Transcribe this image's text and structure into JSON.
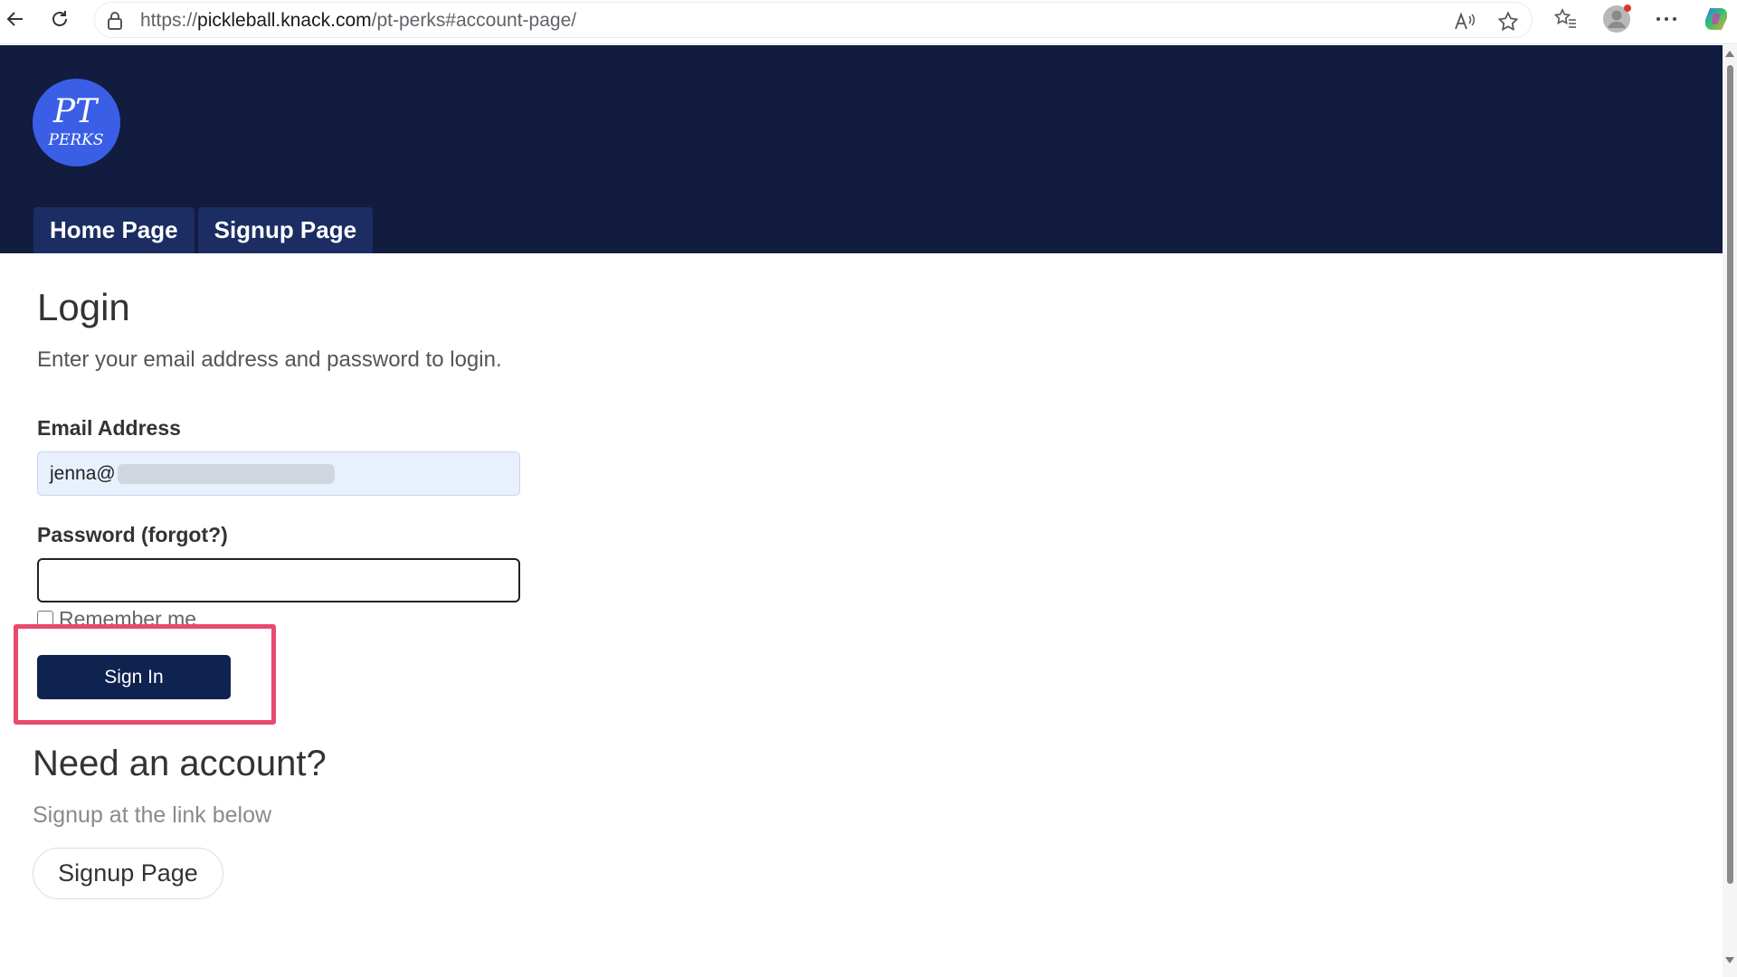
{
  "browser": {
    "url_prefix": "https://",
    "url_host": "pickleball.knack.com",
    "url_path": "/pt-perks#account-page/"
  },
  "header": {
    "logo_text_top": "PT",
    "logo_text_bottom": "PERKS",
    "nav": [
      {
        "label": "Home Page"
      },
      {
        "label": "Signup Page"
      }
    ],
    "bg_color": "#111c3f"
  },
  "login": {
    "title": "Login",
    "description": "Enter your email address and password to login.",
    "email_label": "Email Address",
    "email_value": "jenna@",
    "password_label": "Password (forgot?)",
    "remember_label": "Remember me",
    "sign_in_label": "Sign In"
  },
  "signup": {
    "title": "Need an account?",
    "description": "Signup at the link below",
    "button_label": "Signup Page"
  }
}
